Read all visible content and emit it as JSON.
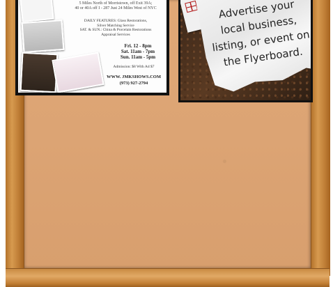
{
  "flyers": [
    {
      "header_lines": [
        "5 Miles North of Morristown, off Exit 39A;",
        "40 or 40A off I - 287 Just 24 Miles West of NYC"
      ],
      "features_lines": [
        "DAILY FEATURES: Glass Restorations,",
        "Silver Matching Service",
        "SAT. & SUN.: China & Porcelain Restorations",
        "Appraisal Services"
      ],
      "hours_lines": [
        "Fri. 12 - 8pm",
        "Sat. 11am - 7pm",
        "Sun. 11am - 5pm"
      ],
      "admission": "Admission: $8   With Ad $7",
      "website": "WWW. JMKSHOWS.COM",
      "phone": "(973) 927-2794"
    }
  ],
  "promo": {
    "line1": "Advertise your",
    "line2": "local business,",
    "line3": "listing, or event on",
    "line4": "the Flyerboard."
  },
  "colors": {
    "cork": "#dca474",
    "frame": "#c98b43",
    "dark_cork": "#3a271a"
  },
  "icons": {
    "pin_card": "calendar-card-icon"
  }
}
